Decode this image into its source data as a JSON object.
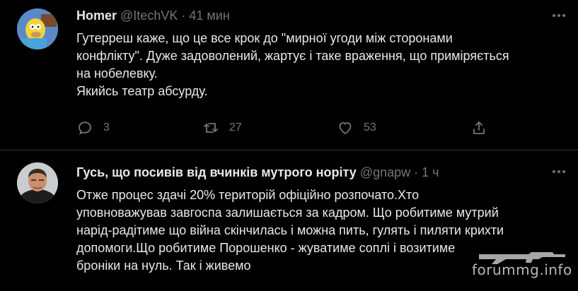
{
  "tweets": [
    {
      "author_name": "Homer",
      "handle": "@ItechVK",
      "separator": "·",
      "time": "41 мин",
      "more_icon": "ellipsis-icon",
      "lines": [
        "Гутерреш каже, що це все крок до \"мирної угоди між сторонами",
        "конфлікту\". Дуже задоволений, жартує і таке враження, що приміряється",
        "на нобелевку.",
        "Якийсь театр абсурду."
      ],
      "actions": {
        "reply_count": "3",
        "retweet_count": "27",
        "like_count": "53"
      }
    },
    {
      "author_name": "Гусь, що посивів від вчинків мутрого норіту",
      "handle": "@gnapw",
      "separator": "·",
      "time": "1 ч",
      "more_icon": "ellipsis-icon",
      "lines": [
        "Отже процес здачі 20% територій офіційно розпочато.Хто",
        "уповноважував завгоспа залишається за кадром. Що робитиме мутрий",
        "нарід-радітиме що війна скінчилась і можна пить, гулять і пиляти крихти",
        "допомоги.Що робитиме Порошенко - жуватиме соплі і возитиме",
        "броніки на нуль. Так і живемо"
      ]
    }
  ],
  "watermark": {
    "text": "forummg.info"
  },
  "colors": {
    "background": "#000000",
    "text": "#e7e9ea",
    "secondary": "#71767b",
    "divider": "#2f3336"
  }
}
